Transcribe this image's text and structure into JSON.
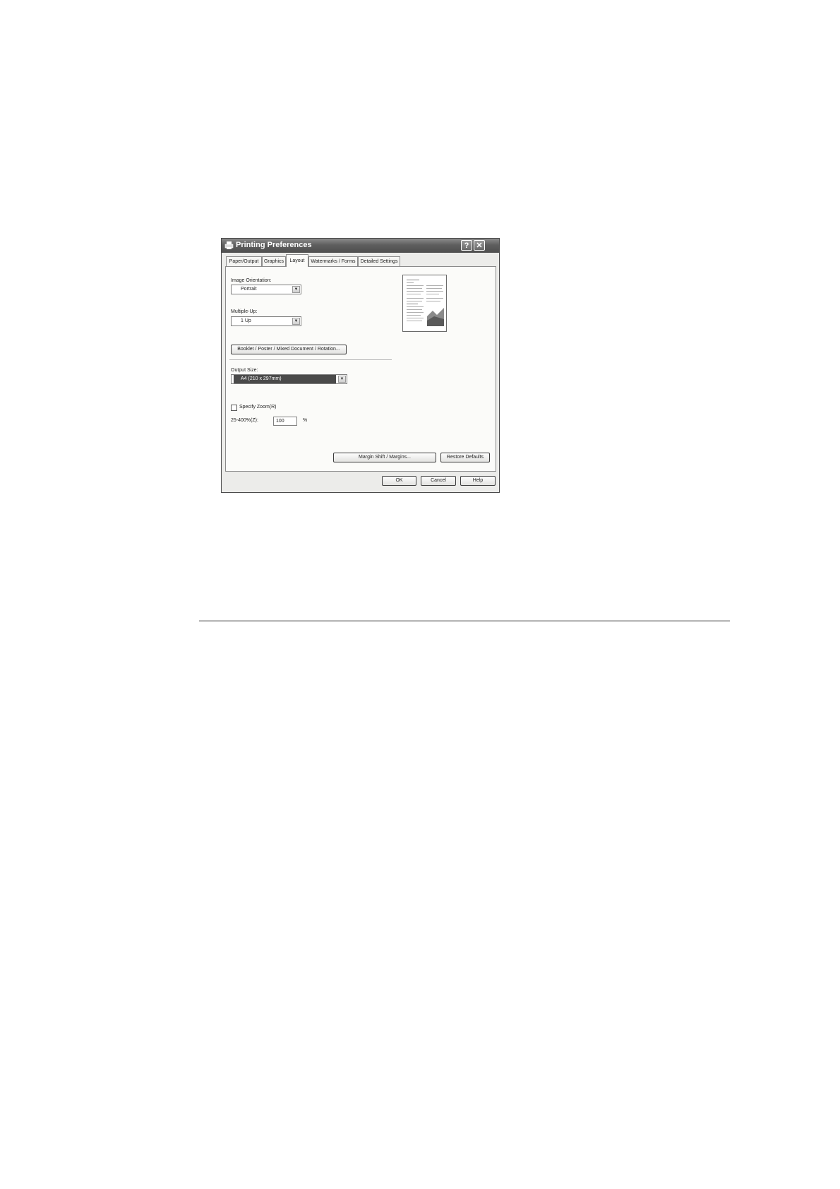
{
  "dialog": {
    "title": "Printing Preferences",
    "help_glyph": "?",
    "close_glyph": "✕",
    "tabs": [
      {
        "label": "Paper/Output"
      },
      {
        "label": "Graphics"
      },
      {
        "label": "Layout"
      },
      {
        "label": "Watermarks / Forms"
      },
      {
        "label": "Detailed Settings"
      }
    ],
    "active_tab": "Layout",
    "layout": {
      "image_orientation_label": "Image Orientation:",
      "image_orientation_value": "Portrait",
      "multiple_up_label": "Multiple-Up:",
      "multiple_up_value": "1 Up",
      "booklet_button": "Booklet / Poster / Mixed Document / Rotation...",
      "output_size_label": "Output Size:",
      "output_size_value": "A4 (210 x 297mm)",
      "specify_zoom_label": "Specify Zoom(R)",
      "specify_zoom_checked": false,
      "zoom_range_label": "25-400%(Z):",
      "zoom_value": "100",
      "zoom_unit": "%",
      "margin_button": "Margin Shift / Margins...",
      "restore_button": "Restore Defaults",
      "preview_icon": "page-preview-icon"
    },
    "buttons": {
      "ok": "OK",
      "cancel": "Cancel",
      "help": "Help"
    }
  },
  "dropdown_arrow_glyph": "▼"
}
